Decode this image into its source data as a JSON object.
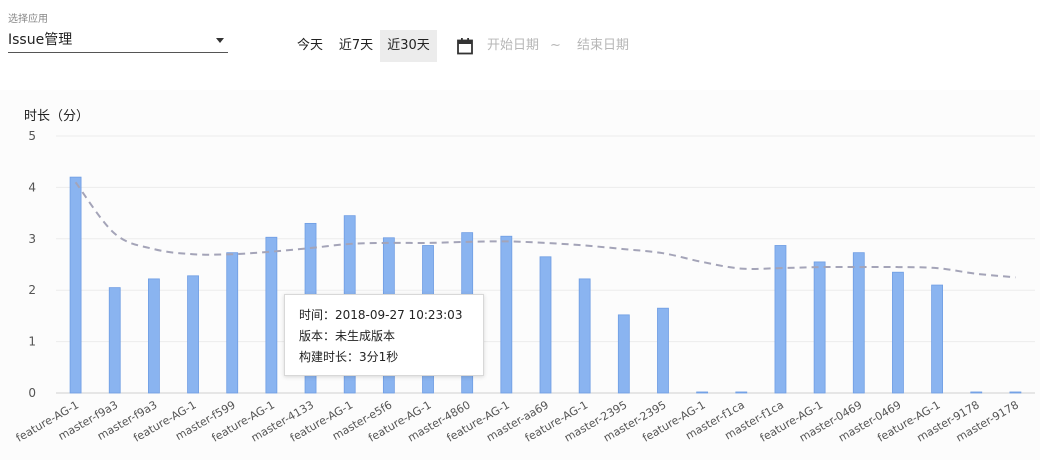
{
  "app_selector": {
    "label": "选择应用",
    "value": "Issue管理"
  },
  "range_buttons": [
    "今天",
    "近7天",
    "近30天"
  ],
  "date_range": {
    "start_placeholder": "开始日期",
    "separator": "~",
    "end_placeholder": "结束日期"
  },
  "tooltip": {
    "time": "时间：2018-09-27 10:23:03",
    "version": "版本：未生成版本",
    "duration": "构建时长：3分1秒"
  },
  "chart_data": {
    "type": "bar",
    "ylabel": "时长（分）",
    "ylim": [
      0,
      5
    ],
    "yticks": [
      0,
      1,
      2,
      3,
      4,
      5
    ],
    "grid": true,
    "categories": [
      "feature-AG-1",
      "master-f9a3",
      "master-f9a3",
      "feature-AG-1",
      "master-f599",
      "feature-AG-1",
      "master-4133",
      "feature-AG-1",
      "master-e5f6",
      "feature-AG-1",
      "master-4860",
      "feature-AG-1",
      "master-aa69",
      "feature-AG-1",
      "master-2395",
      "master-2395",
      "feature-AG-1",
      "master-f1ca",
      "master-f1ca",
      "feature-AG-1",
      "master-0469",
      "master-0469",
      "feature-AG-1",
      "master-9178",
      "master-9178"
    ],
    "series": [
      {
        "type": "bar",
        "color": "#8ab4f0",
        "values": [
          4.2,
          2.05,
          2.22,
          2.28,
          2.73,
          3.03,
          3.3,
          3.45,
          3.02,
          2.87,
          3.12,
          3.05,
          2.65,
          2.22,
          1.52,
          1.65,
          0.02,
          0.02,
          2.87,
          2.55,
          2.73,
          2.35,
          2.1,
          0.02,
          0.02
        ]
      },
      {
        "type": "line",
        "style": "dashed",
        "color": "#a4a4b8",
        "values": [
          4.1,
          3.1,
          2.8,
          2.7,
          2.7,
          2.75,
          2.82,
          2.9,
          2.92,
          2.92,
          2.94,
          2.95,
          2.92,
          2.87,
          2.8,
          2.72,
          2.55,
          2.42,
          2.43,
          2.45,
          2.45,
          2.45,
          2.43,
          2.32,
          2.25
        ]
      }
    ]
  }
}
